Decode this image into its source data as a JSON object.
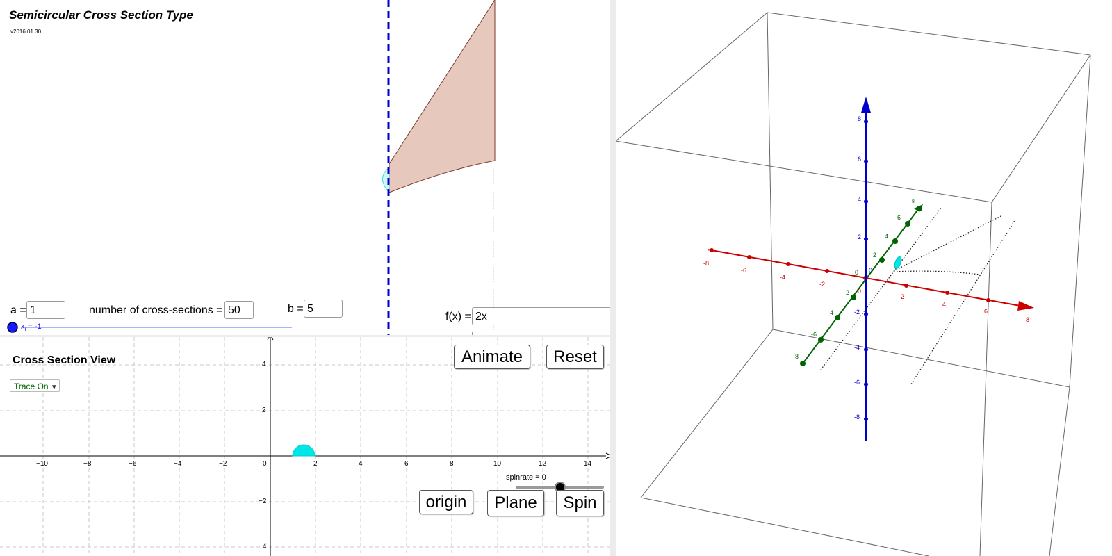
{
  "top_view": {
    "title": "Semicircular Cross Section Type",
    "version": "v2016.01.30",
    "a": {
      "label": "a =",
      "value": "1"
    },
    "n": {
      "label": "number of cross-sections =",
      "value": "50"
    },
    "b": {
      "label": "b =",
      "value": "5"
    },
    "f": {
      "label": "f(x) =",
      "value": "2x"
    },
    "slider": {
      "label": "x",
      "subscript": "i",
      "suffix": "= -1"
    }
  },
  "cross_section_view": {
    "title": "Cross Section View",
    "trace_dropdown": "Trace On",
    "buttons": {
      "animate": "Animate",
      "reset": "Reset",
      "origin": "origin",
      "plane": "Plane",
      "spin": "Spin"
    },
    "spinrate_label": "spinrate = 0",
    "x_ticks": [
      "−10",
      "−8",
      "−6",
      "−4",
      "−2",
      "0",
      "2",
      "4",
      "6",
      "8",
      "10",
      "12",
      "14"
    ],
    "y_ticks": [
      "4",
      "2",
      "−2",
      "−4"
    ]
  },
  "view_3d": {
    "x_ticks": [
      "-8",
      "-6",
      "-4",
      "-2",
      "0",
      "2",
      "4",
      "6",
      "8"
    ],
    "y_ticks": [
      "-8",
      "-6",
      "-4",
      "-2",
      "0",
      "2",
      "4",
      "6",
      "8"
    ],
    "z_ticks": [
      "8",
      "6",
      "4",
      "2",
      "0",
      "-2",
      "-4",
      "-6",
      "-8"
    ],
    "colors": {
      "x_axis": "#cc0000",
      "y_axis": "#006400",
      "z_axis": "#0000cc",
      "region": "#e6c8bc",
      "cross_section": "#00e5e5"
    }
  }
}
